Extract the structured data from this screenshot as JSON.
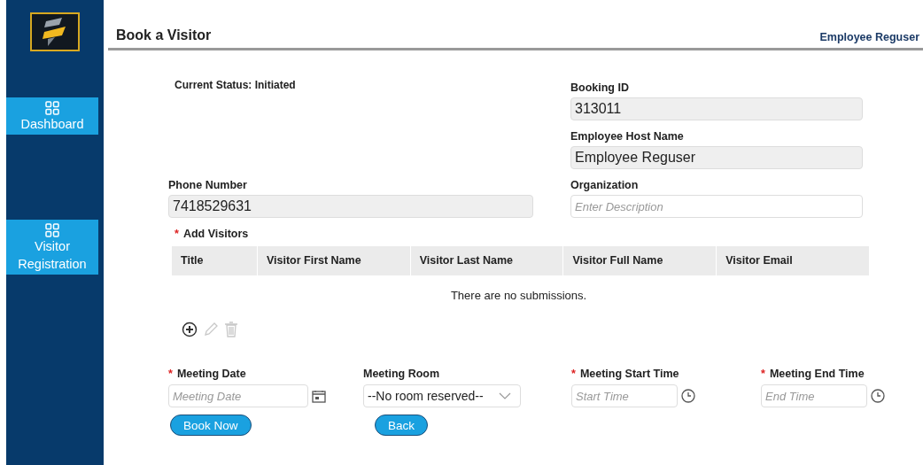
{
  "sidebar": {
    "items": [
      {
        "label": "Dashboard"
      },
      {
        "label": "Visitor Registration"
      }
    ]
  },
  "header": {
    "title": "Book a Visitor",
    "user": "Employee Reguser"
  },
  "status": "Current Status: Initiated",
  "booking_id": {
    "label": "Booking ID",
    "value": "313011"
  },
  "host": {
    "label": "Employee Host Name",
    "value": "Employee Reguser"
  },
  "phone": {
    "label": "Phone Number",
    "value": "7418529631"
  },
  "organization": {
    "label": "Organization",
    "placeholder": "Enter Description"
  },
  "visitors": {
    "label": "Add Visitors",
    "marker": "*",
    "columns": [
      "Title",
      "Visitor First Name",
      "Visitor Last Name",
      "Visitor Full Name",
      "Visitor Email"
    ],
    "empty_message": "There are no submissions."
  },
  "meeting": [
    {
      "kind": "date",
      "label": "Meeting Date",
      "marker": "*",
      "placeholder": "Meeting Date"
    },
    {
      "kind": "select",
      "label": "Meeting Room",
      "value": "--No room reserved--"
    },
    {
      "kind": "time",
      "label": "Meeting Start Time",
      "marker": "*",
      "placeholder": "Start Time"
    },
    {
      "kind": "time",
      "label": "Meeting End Time",
      "marker": "*",
      "placeholder": "End Time"
    }
  ],
  "buttons": [
    "Book Now",
    "Back"
  ]
}
